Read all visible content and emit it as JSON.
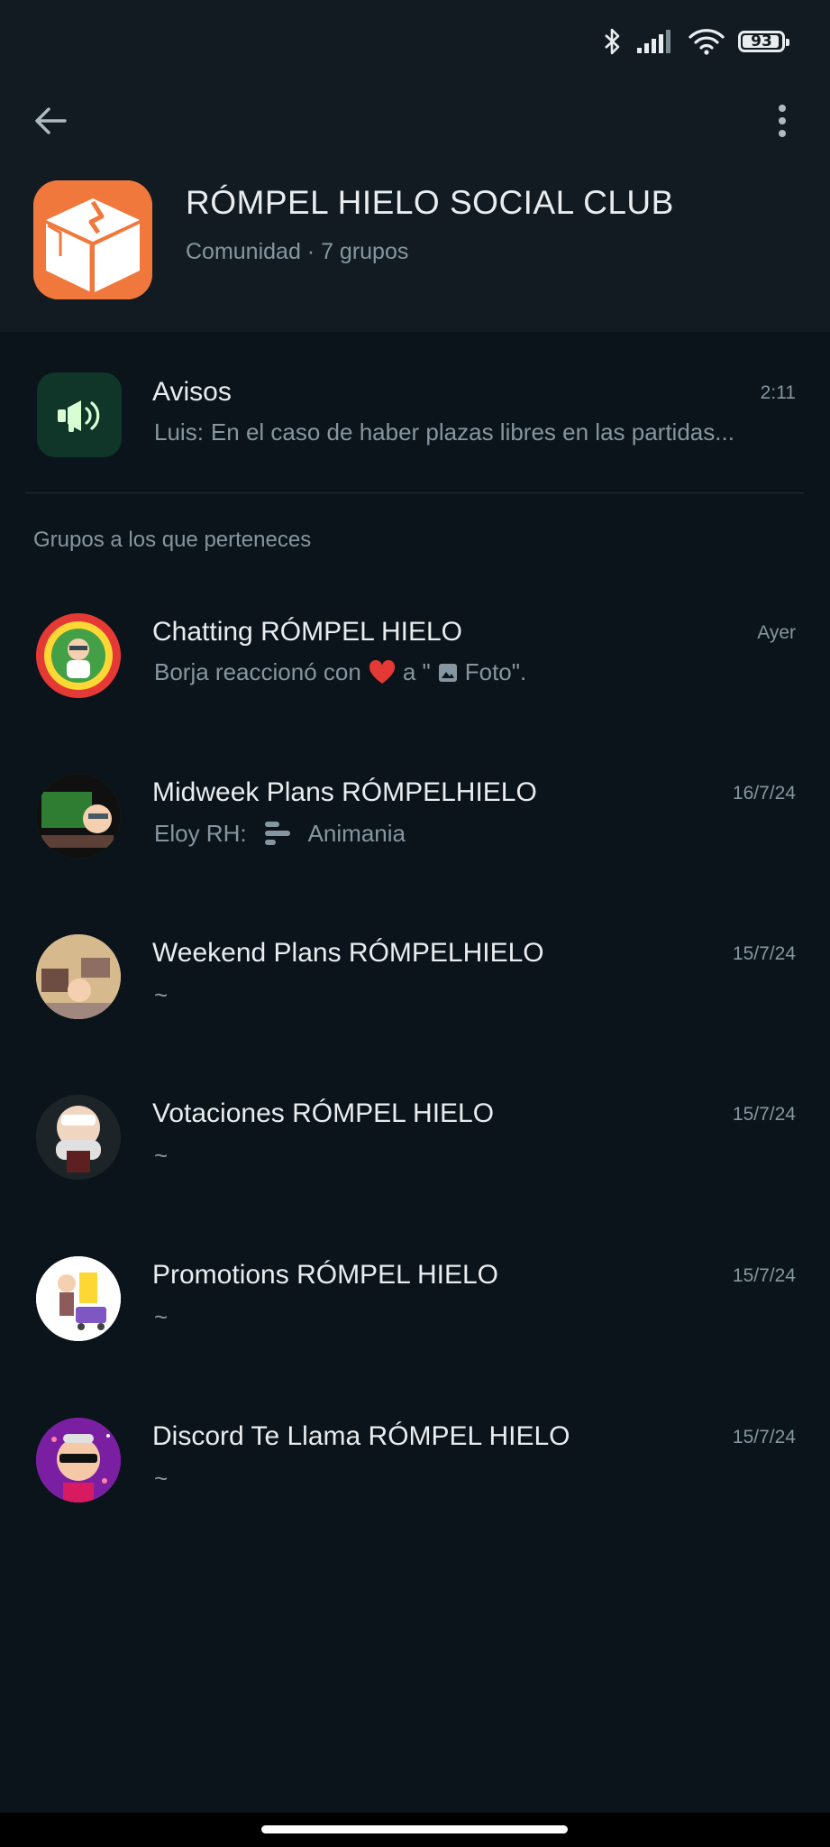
{
  "status_bar": {
    "battery": "93",
    "icons": [
      "bluetooth-icon",
      "signal-icon",
      "wifi-icon",
      "battery-icon"
    ]
  },
  "header": {
    "title": "RÓMPEL HIELO SOCIAL CLUB",
    "subtitle": "Comunidad · 7 grupos"
  },
  "announcements": {
    "name": "Avisos",
    "time": "2:11",
    "sender": "Luis:",
    "preview": "En el caso de haber plazas libres en las partidas..."
  },
  "section_label": "Grupos a los que perteneces",
  "groups": [
    {
      "name": "Chatting RÓMPEL HIELO",
      "time": "Ayer",
      "preview_a": "Borja reaccionó con",
      "preview_b": "a \"",
      "preview_c": "Foto\"."
    },
    {
      "name": "Midweek Plans RÓMPELHIELO",
      "time": "16/7/24",
      "sender": "Eloy RH:",
      "preview": "Animania"
    },
    {
      "name": "Weekend Plans RÓMPELHIELO",
      "time": "15/7/24",
      "preview": "~"
    },
    {
      "name": "Votaciones RÓMPEL HIELO",
      "time": "15/7/24",
      "preview": "~"
    },
    {
      "name": "Promotions RÓMPEL HIELO",
      "time": "15/7/24",
      "preview": "~"
    },
    {
      "name": "Discord Te Llama RÓMPEL HIELO",
      "time": "15/7/24",
      "preview": "~"
    }
  ],
  "colors": {
    "background": "#0b141a",
    "header": "#121b22",
    "muted_text": "#8696a0",
    "accent": "#f0783c"
  }
}
